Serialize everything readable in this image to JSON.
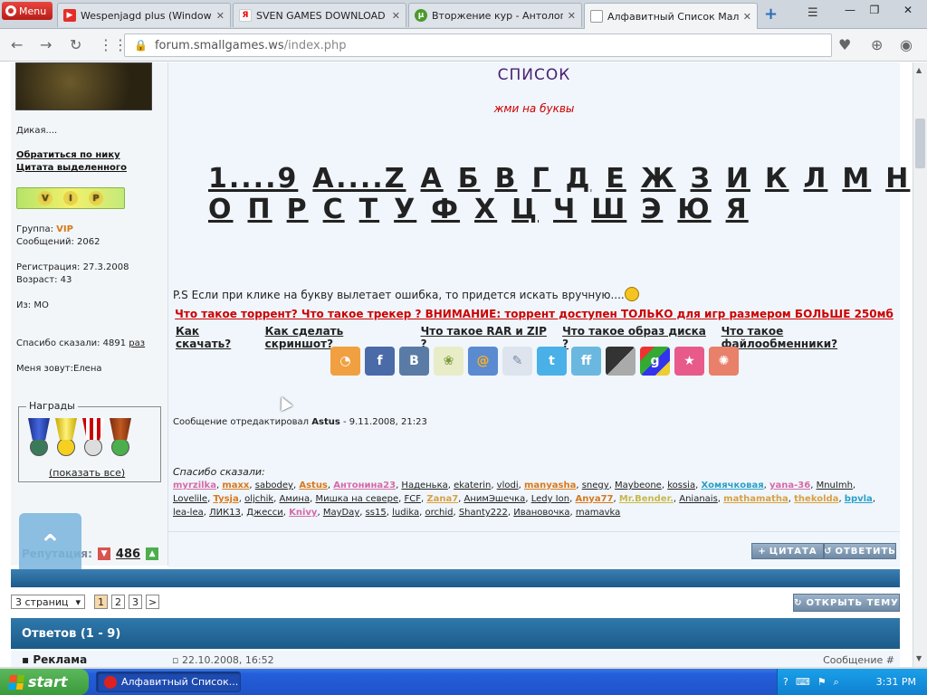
{
  "browser": {
    "menu_label": "Menu",
    "tabs": [
      {
        "label": "Wespenjagd plus (Windows",
        "icon": "youtube-icon"
      },
      {
        "label": "SVEN GAMES DOWNLOAD —",
        "icon": "yandex-icon"
      },
      {
        "label": "Вторжение кур - Антологи",
        "icon": "torrent-icon"
      },
      {
        "label": "Алфавитный Список Мален",
        "icon": "page-icon",
        "active": true
      }
    ],
    "url_host": "forum.smallgames.ws",
    "url_path": "/index.php"
  },
  "sidebar": {
    "status": "Дикая....",
    "link_nick": "Обратиться по нику",
    "link_quote": "Цитата выделенного",
    "vip_text": "V I P",
    "group_label": "Группа: ",
    "group_value": "VIP",
    "messages": "Сообщений: 2062",
    "registered": "Регистрация: 27.3.2008",
    "age": "Возраст: 43",
    "from": "Из: МО",
    "thanked": "Спасибо сказали: 4891",
    "thanked_link": "раз",
    "called": "Меня зовут:Елена",
    "awards_title": "Награды",
    "awards_show": "(показать все)",
    "reputation_label": "Репутация:",
    "reputation_value": "486"
  },
  "post": {
    "title": "СПИСОК",
    "subtitle": "жми на буквы",
    "letters_row1": [
      "1....9",
      "A....Z",
      "А",
      "Б",
      "В",
      "Г",
      "Д",
      "Е",
      "Ж",
      "З",
      "И",
      "К",
      "Л",
      "М",
      "Н"
    ],
    "letters_row2": [
      "О",
      "П",
      "Р",
      "С",
      "Т",
      "У",
      "Ф",
      "Х",
      "Ц",
      "Ч",
      "Ш",
      "Э",
      "Ю",
      "Я"
    ],
    "ps_text": "P.S Если при клике на букву вылетает ошибка, то придется искать вручную....",
    "warning": "Что такое торрент? Что такое трекер ? ВНИМАНИЕ: торрент доступен ТОЛЬКО для игр размером БОЛЬШЕ 250мб",
    "howto": [
      "Как скачать?",
      "Как сделать скриншот?",
      "Что такое RAR и ZIP ?",
      "Что такое образ диска ?",
      "Что такое файлообменники?"
    ],
    "edited_prefix": "Сообщение отредактировал",
    "edited_author": "Astus",
    "edited_date": " - 9.11.2008, 21:23",
    "thanks_title": "Спасибо сказали:",
    "thanks_users": [
      {
        "name": "myrzilka",
        "color": "#d66aa8"
      },
      {
        "name": "maxx",
        "color": "#d8781b"
      },
      {
        "name": "sabodey",
        "color": "#222"
      },
      {
        "name": "Astus",
        "color": "#d8781b"
      },
      {
        "name": "Антонина23",
        "color": "#d66aa8"
      },
      {
        "name": "Наденька",
        "color": "#222"
      },
      {
        "name": "ekaterin",
        "color": "#222"
      },
      {
        "name": "vlodi",
        "color": "#222"
      },
      {
        "name": "manyasha",
        "color": "#d8781b"
      },
      {
        "name": "snegy",
        "color": "#222"
      },
      {
        "name": "Maybeone",
        "color": "#222"
      },
      {
        "name": "kossia",
        "color": "#222"
      },
      {
        "name": "Хомячковая",
        "color": "#2aa0c8"
      },
      {
        "name": "yana-36",
        "color": "#d66aa8"
      },
      {
        "name": "MnuImh",
        "color": "#222"
      },
      {
        "name": "Lovelile",
        "color": "#222"
      },
      {
        "name": "Tysja",
        "color": "#d8781b"
      },
      {
        "name": "oljchik",
        "color": "#222"
      },
      {
        "name": "Амина",
        "color": "#222"
      },
      {
        "name": "Мишка на севере",
        "color": "#222"
      },
      {
        "name": "FCF",
        "color": "#222"
      },
      {
        "name": "Zana7",
        "color": "#d8a040"
      },
      {
        "name": "АнимЭшечка",
        "color": "#222"
      },
      {
        "name": "Ledy Ion",
        "color": "#222"
      },
      {
        "name": "Anya77",
        "color": "#d8781b"
      },
      {
        "name": "Mr.Bender.",
        "color": "#c8b84a"
      },
      {
        "name": "Anianais",
        "color": "#222"
      },
      {
        "name": "mathamatha",
        "color": "#d8a040"
      },
      {
        "name": "thekolda",
        "color": "#d8a040"
      },
      {
        "name": "bpvla",
        "color": "#2aa0c8"
      },
      {
        "name": "lea-lea",
        "color": "#222"
      },
      {
        "name": "ЛИК13",
        "color": "#222"
      },
      {
        "name": "Джесси",
        "color": "#222"
      },
      {
        "name": "Knivy",
        "color": "#d66aa8"
      },
      {
        "name": "MayDay",
        "color": "#222"
      },
      {
        "name": "ss15",
        "color": "#222"
      },
      {
        "name": "ludika",
        "color": "#222"
      },
      {
        "name": "orchid",
        "color": "#222"
      },
      {
        "name": "Shanty222",
        "color": "#222"
      },
      {
        "name": "Ивановочка",
        "color": "#222"
      },
      {
        "name": "mamavka",
        "color": "#222"
      }
    ],
    "quote_btn": "ЦИТАТА",
    "reply_btn": "ОТВЕТИТЬ"
  },
  "pager": {
    "pages_select": "3 страниц",
    "pages": [
      "1",
      "2",
      "3"
    ],
    "next": ">",
    "open_topic": "ОТКРЫТЬ ТЕМУ"
  },
  "answers_bar": "Ответов (1 - 9)",
  "next_post": {
    "author": "Реклама",
    "date": "22.10.2008, 16:52",
    "label": "Сообщение #"
  },
  "taskbar": {
    "start": "start",
    "task": "Алфавитный Список...",
    "clock": "3:31 PM"
  }
}
